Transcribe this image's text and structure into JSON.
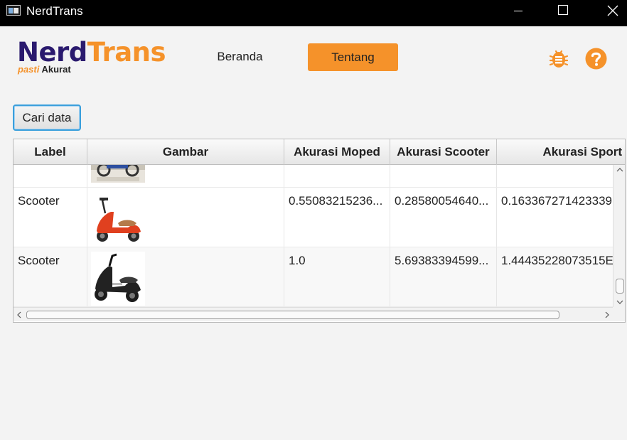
{
  "window": {
    "title": "NerdTrans"
  },
  "logo": {
    "part1": "Nerd",
    "part2": "Trans",
    "tagline_1": "pasti",
    "tagline_2": "Akurat"
  },
  "nav": {
    "beranda": "Beranda",
    "tentang": "Tentang"
  },
  "icons": {
    "bug": "bug-icon",
    "help": "help-icon"
  },
  "colors": {
    "accent": "#f5922a",
    "brand_dark": "#2a1a6e",
    "focus": "#3a9fdc"
  },
  "search": {
    "button_label": "Cari data"
  },
  "table": {
    "columns": [
      "Label",
      "Gambar",
      "Akurasi Moped",
      "Akurasi Scooter",
      "Akurasi Sport"
    ],
    "rows": [
      {
        "label": "",
        "image": "motorcycle-thumbnail",
        "moped": "",
        "scooter": "",
        "sport": ""
      },
      {
        "label": "Scooter",
        "image": "red-scooter-thumbnail",
        "moped": "0.55083215236...",
        "scooter": "0.28580054640...",
        "sport": "0.163367271423339"
      },
      {
        "label": "Scooter",
        "image": "black-scooter-thumbnail",
        "moped": "1.0",
        "scooter": "5.69383394599...",
        "sport": "1.44435228073515E"
      }
    ]
  }
}
